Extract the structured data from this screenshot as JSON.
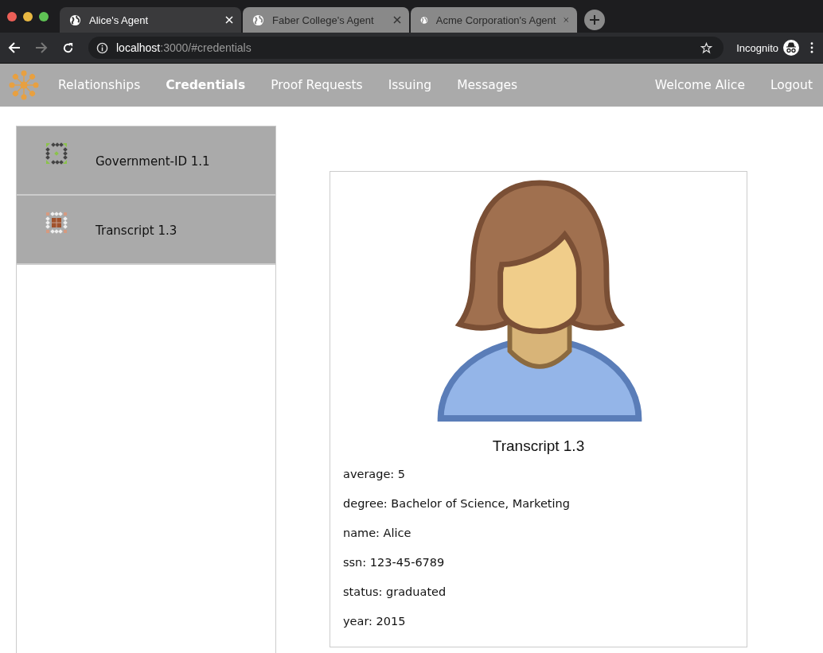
{
  "browser": {
    "tabs": [
      {
        "title": "Alice's Agent",
        "selected": true
      },
      {
        "title": "Faber College's Agent",
        "selected": false
      },
      {
        "title": "Acme Corporation's Agent",
        "selected": false
      }
    ],
    "url_host": "localhost",
    "url_rest": ":3000/#credentials",
    "profile": "Incognito"
  },
  "nav": {
    "items": [
      {
        "label": "Relationships",
        "selected": false
      },
      {
        "label": "Credentials",
        "selected": true
      },
      {
        "label": "Proof Requests",
        "selected": false
      },
      {
        "label": "Issuing",
        "selected": false
      },
      {
        "label": "Messages",
        "selected": false
      }
    ],
    "welcome": "Welcome Alice",
    "logout": "Logout"
  },
  "credentials": [
    {
      "name": "Government-ID 1.1",
      "kind": "id"
    },
    {
      "name": "Transcript 1.3",
      "kind": "transcript"
    }
  ],
  "detail": {
    "title": "Transcript 1.3",
    "attributes": [
      "average: 5",
      "degree: Bachelor of Science, Marketing",
      "name: Alice",
      "ssn: 123-45-6789",
      "status: graduated",
      "year: 2015"
    ]
  }
}
